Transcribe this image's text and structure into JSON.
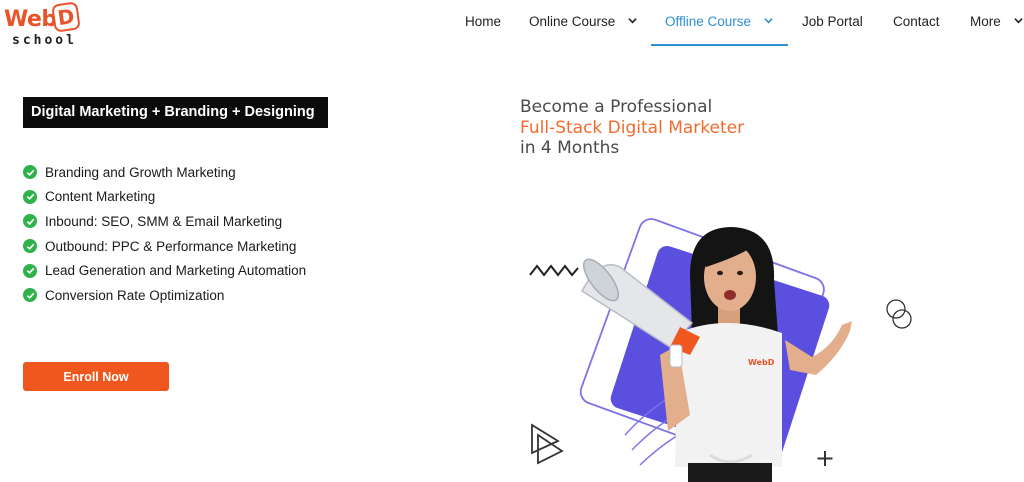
{
  "brand": {
    "logo_main": "Web",
    "logo_letter": "D",
    "logo_sub": "school"
  },
  "nav": {
    "items": [
      {
        "label": "Home",
        "has_dropdown": false,
        "active": false
      },
      {
        "label": "Online Course",
        "has_dropdown": true,
        "active": false
      },
      {
        "label": "Offline Course",
        "has_dropdown": true,
        "active": true
      },
      {
        "label": "Job Portal",
        "has_dropdown": false,
        "active": false
      },
      {
        "label": "Contact",
        "has_dropdown": false,
        "active": false
      },
      {
        "label": "More",
        "has_dropdown": true,
        "active": false
      }
    ]
  },
  "hero_left": {
    "headline": "Digital Marketing + Branding + Designing",
    "features": [
      "Branding and Growth Marketing",
      "Content Marketing",
      "Inbound: SEO, SMM & Email Marketing",
      "Outbound: PPC & Performance Marketing",
      "Lead Generation and Marketing Automation",
      "Conversion Rate Optimization"
    ],
    "cta_label": "Enroll Now"
  },
  "hero_right": {
    "line1": "Become a Professional",
    "line2": "Full-Stack Digital Marketer",
    "line3": "in 4 Months",
    "shirt_logo": "WebD"
  },
  "colors": {
    "brand_orange": "#f0571f",
    "accent_orange": "#f26b2d",
    "active_blue": "#2f8fd0",
    "check_green": "#2fb24a",
    "violet": "#5b4fe0"
  },
  "icons": [
    "check-circle-icon",
    "chevron-down-icon",
    "megaphone-icon",
    "zigzag-icon",
    "circles-icon",
    "play-triangle-icon",
    "plus-icon"
  ]
}
